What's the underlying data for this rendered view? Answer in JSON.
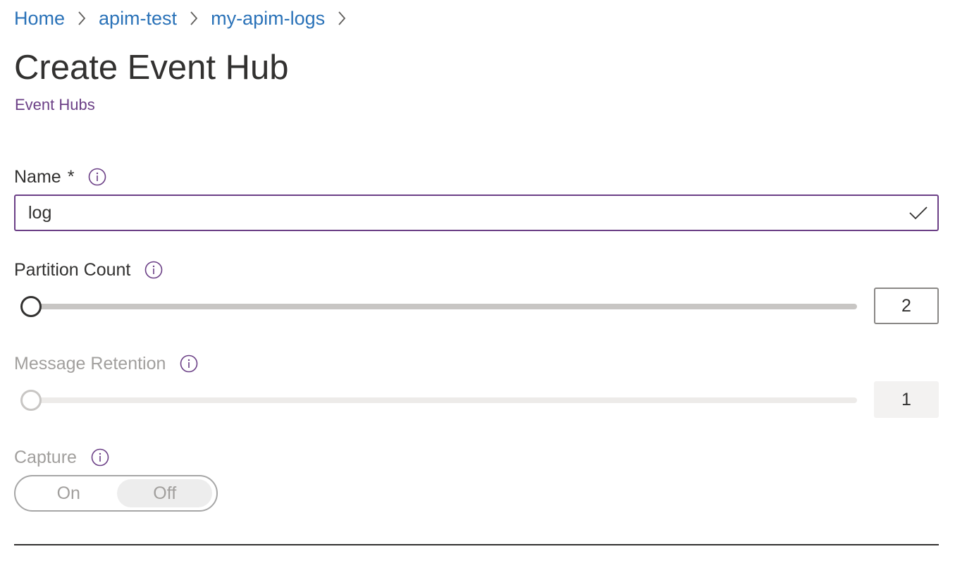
{
  "breadcrumb": {
    "items": [
      "Home",
      "apim-test",
      "my-apim-logs"
    ]
  },
  "page": {
    "title": "Create Event Hub",
    "subtitle": "Event Hubs"
  },
  "form": {
    "name": {
      "label": "Name",
      "required_mark": "*",
      "value": "log"
    },
    "partition_count": {
      "label": "Partition Count",
      "value": "2"
    },
    "message_retention": {
      "label": "Message Retention",
      "value": "1"
    },
    "capture": {
      "label": "Capture",
      "on_label": "On",
      "off_label": "Off",
      "selected": "Off"
    }
  },
  "colors": {
    "link": "#2a72b8",
    "accent_purple": "#6b3f86",
    "text": "#323130",
    "disabled_text": "#a19f9d"
  },
  "icons": [
    "chevron-right-icon",
    "info-icon",
    "checkmark-icon"
  ]
}
